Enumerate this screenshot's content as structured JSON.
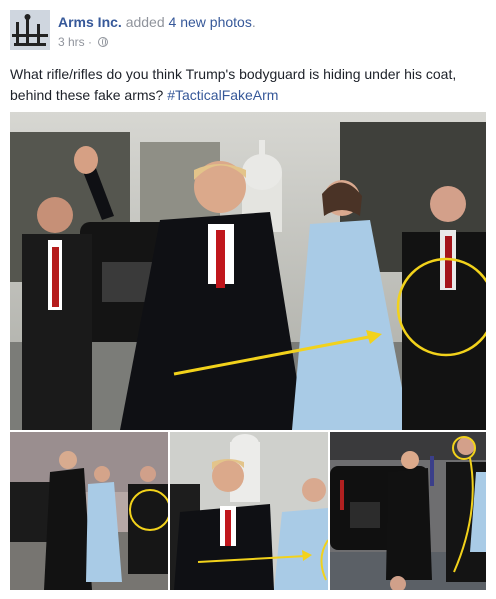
{
  "post": {
    "page_name": "Arms Inc.",
    "action_prefix": "added",
    "action_count": "4 new photos",
    "action_suffix": ".",
    "timestamp": "3 hrs",
    "separator": "·",
    "audience_icon": "globe-icon",
    "text": "What rifle/rifles do you think Trump's bodyguard is hiding under his coat, behind these fake arms?",
    "hashtag": "#TacticalFakeArm"
  },
  "photos": [
    {
      "id": "main",
      "annotation_color": "#f2d21b"
    },
    {
      "id": "thumb-1",
      "annotation_color": "#f2d21b"
    },
    {
      "id": "thumb-2",
      "annotation_color": "#f2d21b"
    },
    {
      "id": "thumb-3",
      "annotation_color": "#f2d21b"
    }
  ],
  "colors": {
    "link": "#365899",
    "muted": "#90949c",
    "text": "#1d2129"
  }
}
